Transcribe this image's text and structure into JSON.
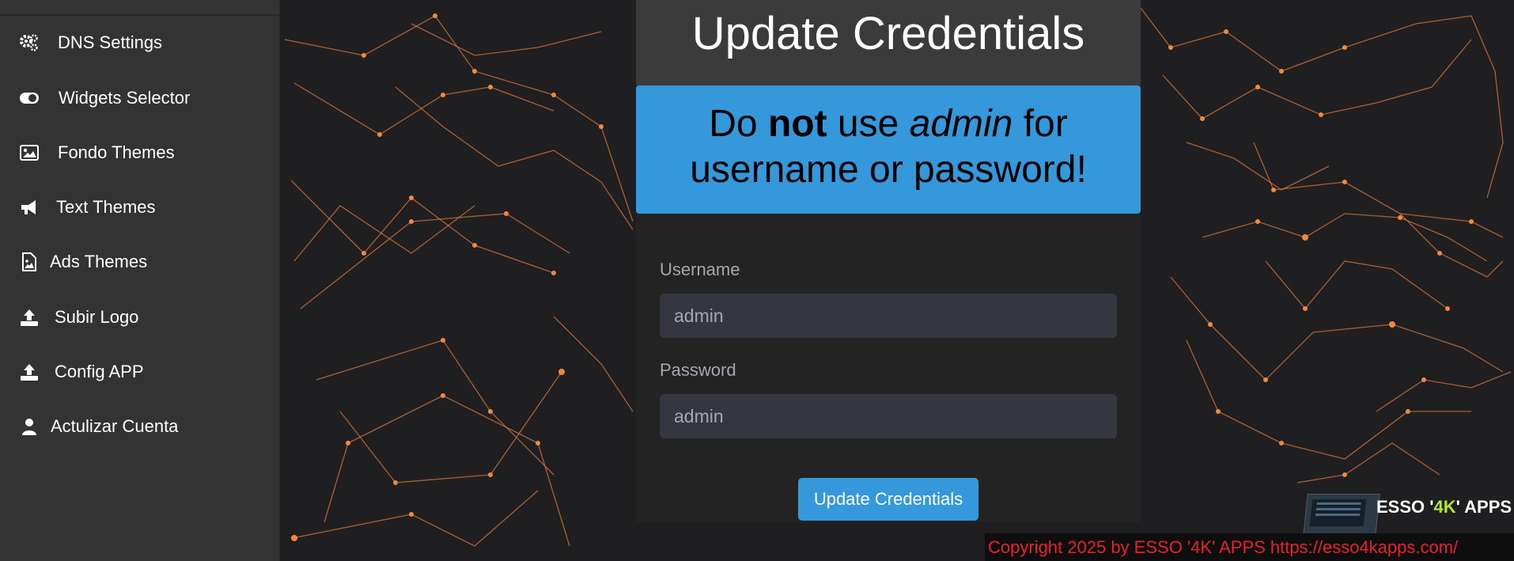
{
  "sidebar": {
    "items": [
      {
        "label": "DNS Settings",
        "icon": "gears-icon"
      },
      {
        "label": "Widgets Selector",
        "icon": "toggle-icon"
      },
      {
        "label": "Fondo Themes",
        "icon": "image-icon"
      },
      {
        "label": "Text Themes",
        "icon": "megaphone-icon"
      },
      {
        "label": "Ads Themes",
        "icon": "file-image-icon"
      },
      {
        "label": "Subir Logo",
        "icon": "upload-icon"
      },
      {
        "label": "Config APP",
        "icon": "upload-icon"
      },
      {
        "label": "Actulizar Cuenta",
        "icon": "user-icon"
      }
    ]
  },
  "main": {
    "title": "Update Credentials",
    "warning": {
      "pre": "Do ",
      "bold": "not",
      "mid": " use ",
      "italic": "admin",
      "post": " for",
      "line2": "username or password!"
    },
    "username": {
      "label": "Username",
      "value": "admin"
    },
    "password": {
      "label": "Password",
      "value": "admin"
    },
    "submit_label": "Update Credentials"
  },
  "brand": {
    "prefix": "ESSO '",
    "highlight": "4K",
    "suffix": "' APPS"
  },
  "footer": {
    "copyright": "Copyright 2025  by ESSO '4K' APPS https://esso4kapps.com/"
  },
  "colors": {
    "accent": "#3498db",
    "network": "#f08a3c",
    "copyright": "#e8212b"
  }
}
